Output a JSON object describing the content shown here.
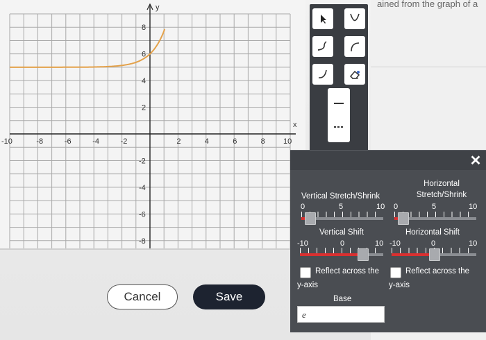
{
  "header": {
    "text": "ained from the graph of a"
  },
  "graph": {
    "x_label": "x",
    "y_label": "y",
    "x_ticks": [
      "-10",
      "-8",
      "-6",
      "-4",
      "-2",
      "2",
      "4",
      "6",
      "8",
      "10"
    ],
    "y_ticks": [
      "8",
      "6",
      "4",
      "2",
      "-2",
      "-4",
      "-6",
      "-8"
    ],
    "x_range": [
      -10,
      10
    ],
    "y_range": [
      -9,
      9
    ],
    "curve_color": "#e3a14a",
    "curve": {
      "type": "exponential",
      "base": "e",
      "vertical_stretch": 1,
      "vertical_shift": 5,
      "horizontal_shift": 0
    }
  },
  "toolbar": {
    "tools": [
      "pointer-icon",
      "parabola-icon",
      "curve-up-icon",
      "curve-arc-icon",
      "curve-down-icon",
      "eraser-icon",
      "solid-line-icon",
      "dashed-line-icon"
    ]
  },
  "dialog": {
    "close_label": "✕",
    "vertical_stretch": {
      "label": "Vertical Stretch/Shrink",
      "min": "0",
      "mid": "5",
      "max": "10",
      "value": 1
    },
    "horizontal_stretch": {
      "label_line1": "Horizontal",
      "label_line2": "Stretch/Shrink",
      "min": "0",
      "mid": "5",
      "max": "10",
      "value": 1
    },
    "vertical_shift": {
      "label": "Vertical Shift",
      "min": "-10",
      "mid": "0",
      "max": "10",
      "value": 5
    },
    "horizontal_shift": {
      "label": "Horizontal Shift",
      "min": "-10",
      "mid": "0",
      "max": "10",
      "value": 0
    },
    "reflect_y": {
      "label_line1": "Reflect across the",
      "label_line2": "y-axis"
    },
    "reflect_x": {
      "label_line1": "Reflect across the",
      "label_line2": "y-axis"
    },
    "base_label": "Base",
    "base_value": "e",
    "accent": "#d93030"
  },
  "buttons": {
    "cancel": "Cancel",
    "save": "Save"
  }
}
